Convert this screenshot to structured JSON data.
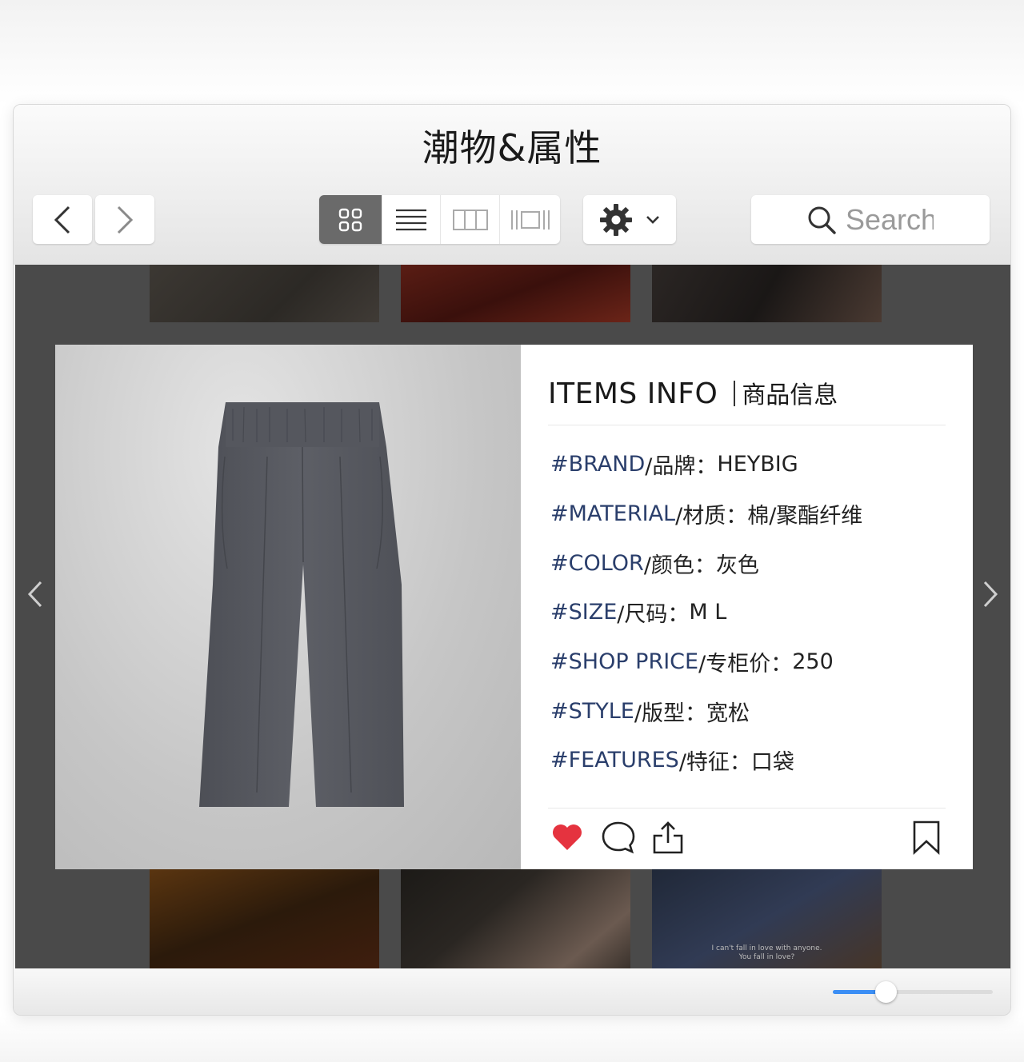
{
  "window": {
    "title": "潮物&属性"
  },
  "toolbar": {
    "back_icon": "chevron-left-icon",
    "forward_icon": "chevron-right-icon",
    "view_modes": [
      "grid-view-icon",
      "list-view-icon",
      "columns-view-icon",
      "coverflow-view-icon"
    ],
    "active_view": "grid-view-icon",
    "action_icon": "gear-icon",
    "search": {
      "placeholder": "Search"
    }
  },
  "gallery": {
    "caption": "I can't fall in love with anyone.\nYou fall in love?"
  },
  "item": {
    "image": "gray-pants",
    "title": "ITEMS INFO",
    "subtitle": "商品信息",
    "attributes": [
      {
        "key": "#BRAND",
        "label": "/品牌：",
        "value": "HEYBIG"
      },
      {
        "key": "#MATERIAL",
        "label": "/材质：",
        "value": "棉/聚酯纤维"
      },
      {
        "key": "#COLOR",
        "label": "/颜色：",
        "value": "灰色"
      },
      {
        "key": "#SIZE",
        "label": "/尺码：",
        "value": "M L"
      },
      {
        "key": "#SHOP PRICE",
        "label": "/专柜价：",
        "value": "250"
      },
      {
        "key": "#STYLE",
        "label": "/版型：",
        "value": "宽松"
      },
      {
        "key": "#FEATURES",
        "label": "/特征：",
        "value": "口袋"
      }
    ],
    "key_color": "#2a3e6b",
    "like_color": "#e5333f"
  },
  "zoom": {
    "level": 0.33,
    "accent": "#3b8ef5"
  }
}
